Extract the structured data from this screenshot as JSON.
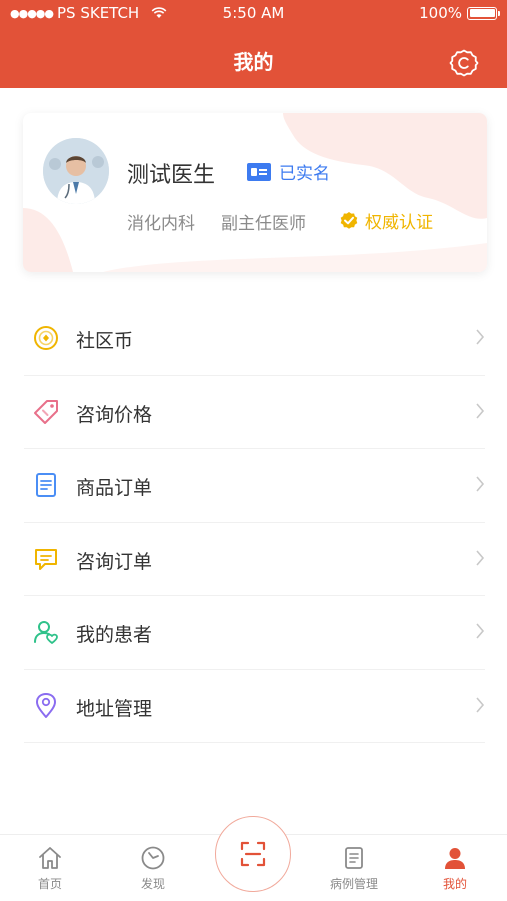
{
  "status_bar": {
    "carrier": "PS SKETCH",
    "time": "5:50 AM",
    "battery": "100%"
  },
  "nav": {
    "title": "我的"
  },
  "profile": {
    "name": "测试医生",
    "verified_label": "已实名",
    "department": "消化内科",
    "position": "副主任医师",
    "authority_label": "权威认证"
  },
  "menu": [
    {
      "label": "社区币",
      "icon": "coin-icon",
      "color": "#f0b500"
    },
    {
      "label": "咨询价格",
      "icon": "price-tag-icon",
      "color": "#e8708a"
    },
    {
      "label": "商品订单",
      "icon": "document-icon",
      "color": "#4b8ef5"
    },
    {
      "label": "咨询订单",
      "icon": "chat-icon",
      "color": "#f0b500"
    },
    {
      "label": "我的患者",
      "icon": "patient-icon",
      "color": "#2fc28a"
    },
    {
      "label": "地址管理",
      "icon": "location-pin-icon",
      "color": "#8a6cf0"
    }
  ],
  "tabbar": [
    {
      "label": "首页",
      "icon": "home-icon",
      "active": false
    },
    {
      "label": "发现",
      "icon": "compass-icon",
      "active": false
    },
    {
      "label": "",
      "icon": "scan-icon",
      "active": false
    },
    {
      "label": "病例管理",
      "icon": "clipboard-icon",
      "active": false
    },
    {
      "label": "我的",
      "icon": "user-icon",
      "active": true
    }
  ],
  "colors": {
    "brand": "#e25238",
    "verified": "#3d7bf0",
    "authority": "#f0b500"
  }
}
